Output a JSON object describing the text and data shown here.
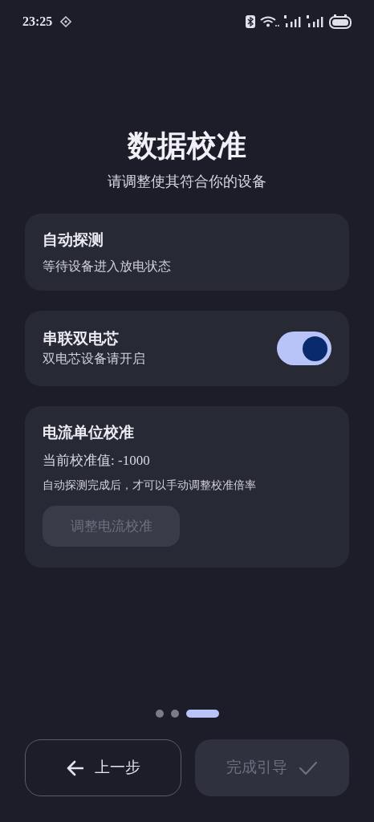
{
  "status_bar": {
    "time": "23:25"
  },
  "title": "数据校准",
  "subtitle": "请调整使其符合你的设备",
  "cards": [
    {
      "kind": "info",
      "title": "自动探测",
      "description": "等待设备进入放电状态"
    },
    {
      "kind": "toggle",
      "title": "串联双电芯",
      "description": "双电芯设备请开启",
      "on": true
    },
    {
      "kind": "calibration",
      "title": "电流单位校准",
      "value_line": "当前校准值: -1000",
      "note": "自动探测完成后，才可以手动调整校准倍率",
      "button": {
        "label": "调整电流校准",
        "disabled": true
      }
    }
  ],
  "pager": [
    {
      "selected": false
    },
    {
      "selected": false
    },
    {
      "selected": true
    }
  ],
  "back_button": {
    "label": "上一步",
    "disabled": false
  },
  "finish_button": {
    "label": "完成引导",
    "disabled": true
  }
}
